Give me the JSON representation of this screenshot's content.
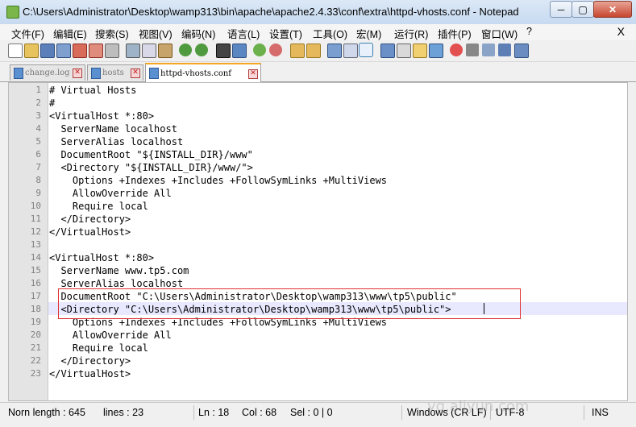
{
  "window": {
    "title": "C:\\Users\\Administrator\\Desktop\\wamp313\\bin\\apache\\apache2.4.33\\conf\\extra\\httpd-vhosts.conf - Notepad",
    "min_glyph": "─",
    "max_glyph": "▢",
    "close_glyph": "✕"
  },
  "menu": {
    "items": [
      "文件(F)",
      "编辑(E)",
      "搜索(S)",
      "视图(V)",
      "编码(N)",
      "语言(L)",
      "设置(T)",
      "工具(O)",
      "宏(M)",
      "运行(R)",
      "插件(P)",
      "窗口(W)",
      "?"
    ],
    "close_label": "X"
  },
  "toolbar": {
    "icons": [
      "new-file-icon",
      "open-file-icon",
      "save-icon",
      "save-all-icon",
      "close-icon",
      "close-all-icon",
      "print-icon",
      "cut-icon",
      "copy-icon",
      "paste-icon",
      "undo-icon",
      "redo-icon",
      "find-icon",
      "replace-icon",
      "zoom-in-icon",
      "zoom-out-icon",
      "sync-vertical-icon",
      "sync-horizontal-icon",
      "word-wrap-icon",
      "show-all-chars-icon",
      "indent-guide-icon",
      "language-icon",
      "function-list-icon",
      "folder-icon",
      "monitor-icon",
      "record-macro-icon",
      "stop-macro-icon",
      "play-macro-icon",
      "play-multiple-icon",
      "save-macro-icon"
    ]
  },
  "tabs": [
    {
      "label": "change.log",
      "active": false
    },
    {
      "label": "hosts",
      "active": false
    },
    {
      "label": "httpd-vhosts.conf",
      "active": true
    }
  ],
  "tab_close_glyph": "✕",
  "editor": {
    "lines": [
      {
        "n": "1",
        "text": "# Virtual Hosts"
      },
      {
        "n": "2",
        "text": "#"
      },
      {
        "n": "3",
        "text": "<VirtualHost *:80>"
      },
      {
        "n": "4",
        "text": "  ServerName localhost"
      },
      {
        "n": "5",
        "text": "  ServerAlias localhost"
      },
      {
        "n": "6",
        "text": "  DocumentRoot \"${INSTALL_DIR}/www\""
      },
      {
        "n": "7",
        "text": "  <Directory \"${INSTALL_DIR}/www/\">"
      },
      {
        "n": "8",
        "text": "    Options +Indexes +Includes +FollowSymLinks +MultiViews"
      },
      {
        "n": "9",
        "text": "    AllowOverride All"
      },
      {
        "n": "10",
        "text": "    Require local"
      },
      {
        "n": "11",
        "text": "  </Directory>"
      },
      {
        "n": "12",
        "text": "</VirtualHost>"
      },
      {
        "n": "13",
        "text": ""
      },
      {
        "n": "14",
        "text": "<VirtualHost *:80>"
      },
      {
        "n": "15",
        "text": "  ServerName www.tp5.com"
      },
      {
        "n": "16",
        "text": "  ServerAlias localhost"
      },
      {
        "n": "17",
        "text": "  DocumentRoot \"C:\\Users\\Administrator\\Desktop\\wamp313\\www\\tp5\\public\""
      },
      {
        "n": "18",
        "text": "  <Directory \"C:\\Users\\Administrator\\Desktop\\wamp313\\www\\tp5\\public\">"
      },
      {
        "n": "19",
        "text": "    Options +Indexes +Includes +FollowSymLinks +MultiViews"
      },
      {
        "n": "20",
        "text": "    AllowOverride All"
      },
      {
        "n": "21",
        "text": "    Require local"
      },
      {
        "n": "22",
        "text": "  </Directory>"
      },
      {
        "n": "23",
        "text": "</VirtualHost>"
      }
    ]
  },
  "status": {
    "length": "Norn length : 645",
    "lines": "lines : 23",
    "ln": "Ln : 18",
    "col": "Col : 68",
    "sel": "Sel : 0 | 0",
    "eol": "Windows (CR LF)",
    "encoding": "UTF-8",
    "mode": "INS"
  },
  "watermark": "yq.aliyun.com",
  "colors": {
    "current_line": "#e8e8ff",
    "highlight_box": "#e03030",
    "active_tab_accent": "#f5a623"
  }
}
